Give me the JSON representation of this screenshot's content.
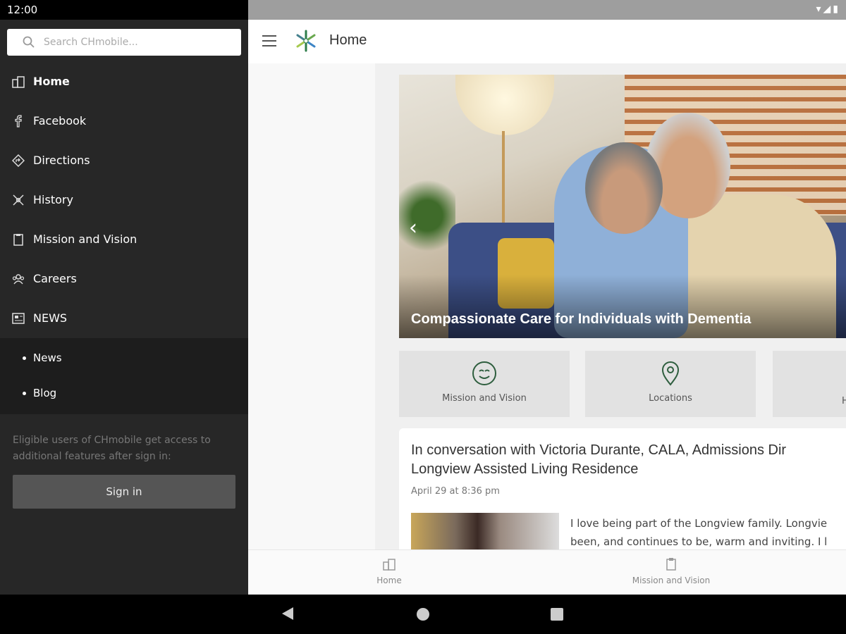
{
  "status": {
    "time": "12:00"
  },
  "toolbar": {
    "title": "Home"
  },
  "search": {
    "placeholder": "Search CHmobile..."
  },
  "menu": {
    "items": [
      {
        "label": "Home",
        "icon": "building-icon"
      },
      {
        "label": "Facebook",
        "icon": "facebook-icon"
      },
      {
        "label": "Directions",
        "icon": "directions-icon"
      },
      {
        "label": "History",
        "icon": "history-icon"
      },
      {
        "label": "Mission and Vision",
        "icon": "clipboard-icon"
      },
      {
        "label": "Careers",
        "icon": "people-icon"
      },
      {
        "label": "NEWS",
        "icon": "newspaper-icon"
      }
    ],
    "subitems": [
      {
        "label": "News"
      },
      {
        "label": "Blog"
      }
    ]
  },
  "drawer": {
    "note": "Eligible users of CHmobile get access to additional features after sign in:",
    "signin_label": "Sign in"
  },
  "hero": {
    "caption": "Compassionate Care for Individuals with Dementia"
  },
  "tiles": [
    {
      "label": "Mission and Vision",
      "icon": "smiley-icon"
    },
    {
      "label": "Locations",
      "icon": "location-pin-icon"
    },
    {
      "label": "H",
      "icon": ""
    }
  ],
  "post": {
    "title_line1": "In conversation with Victoria Durante, CALA, Admissions Dir",
    "title_line2": "Longview Assisted Living Residence",
    "date": "April 29 at 8:36 pm",
    "excerpt_line1": "I love being part of the Longview family. Longvie",
    "excerpt_line2": "been, and continues to be, warm and inviting. I l"
  },
  "bottomnav": [
    {
      "label": "Home",
      "icon": "building-icon"
    },
    {
      "label": "Mission and Vision",
      "icon": "clipboard-icon"
    }
  ],
  "colors": {
    "drawer_bg": "#272727",
    "brand_green": "#2e7d4a",
    "tile_bg": "#e2e2e2"
  }
}
